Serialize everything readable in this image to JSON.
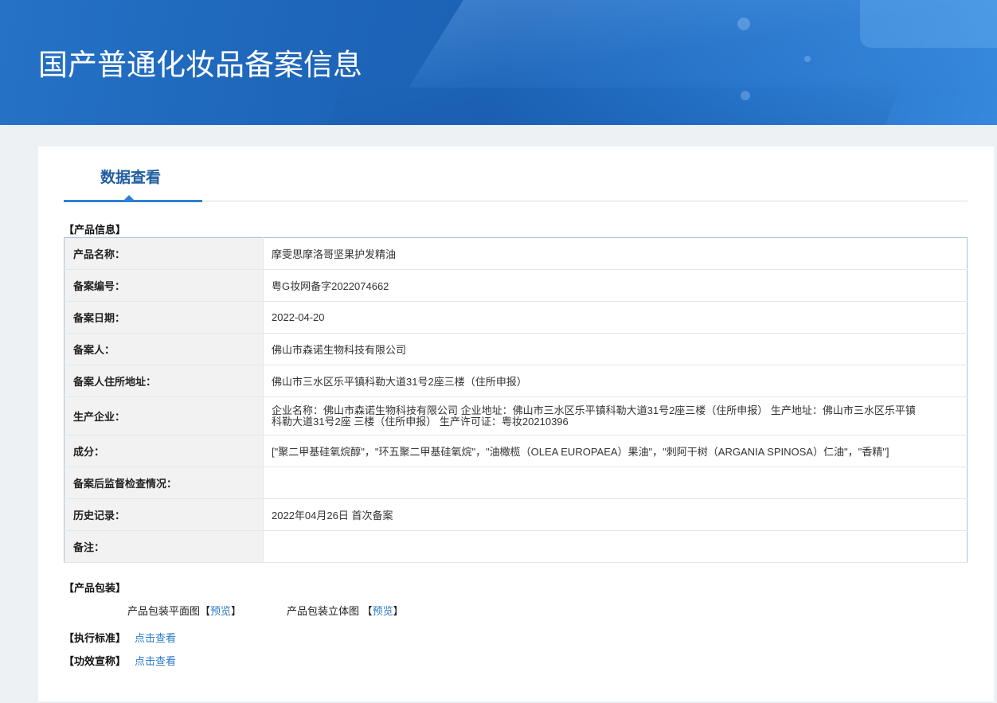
{
  "header": {
    "title": "国产普通化妆品备案信息"
  },
  "tabs": {
    "active_label": "数据查看"
  },
  "product_info": {
    "section_title": "【产品信息】",
    "rows": [
      {
        "label": "产品名称：",
        "value": "摩雯思摩洛哥坚果护发精油"
      },
      {
        "label": "备案编号：",
        "value": "粤G妆网备字2022074662"
      },
      {
        "label": "备案日期：",
        "value": "2022-04-20"
      },
      {
        "label": "备案人：",
        "value": "佛山市森诺生物科技有限公司"
      },
      {
        "label": "备案人住所地址：",
        "value": "佛山市三水区乐平镇科勒大道31号2座三楼（住所申报）"
      },
      {
        "label": "生产企业：",
        "value": "企业名称：佛山市森诺生物科技有限公司 企业地址：佛山市三水区乐平镇科勒大道31号2座三楼（住所申报） 生产地址：佛山市三水区乐平镇科勒大道31号2座 三楼（住所申报） 生产许可证：粤妆20210396"
      },
      {
        "label": "成分：",
        "value": "[\"聚二甲基硅氧烷醇\"，\"环五聚二甲基硅氧烷\"，\"油橄榄（OLEA EUROPAEA）果油\"，\"刺阿干树（ARGANIA SPINOSA）仁油\"，\"香精\"]"
      },
      {
        "label": "备案后监督检查情况：",
        "value": ""
      },
      {
        "label": "历史记录：",
        "value": "2022年04月26日 首次备案"
      },
      {
        "label": "备注：",
        "value": ""
      }
    ]
  },
  "packaging": {
    "section_title": "【产品包装】",
    "items": [
      {
        "label": "产品包装平面图",
        "open": "【",
        "link": "预览",
        "close": "】"
      },
      {
        "label": "产品包装立体图 ",
        "open": "【",
        "link": "预览",
        "close": "】"
      }
    ]
  },
  "standards": {
    "section_title": "【执行标准】",
    "link": "点击查看"
  },
  "claims": {
    "section_title": "【功效宣称】",
    "link": "点击查看"
  },
  "colors": {
    "header_blue": "#1e66ba",
    "accent": "#2f80d4",
    "link": "#2c7bc9",
    "table_border": "#a9c3dd",
    "label_bg": "#f2f2f2"
  }
}
